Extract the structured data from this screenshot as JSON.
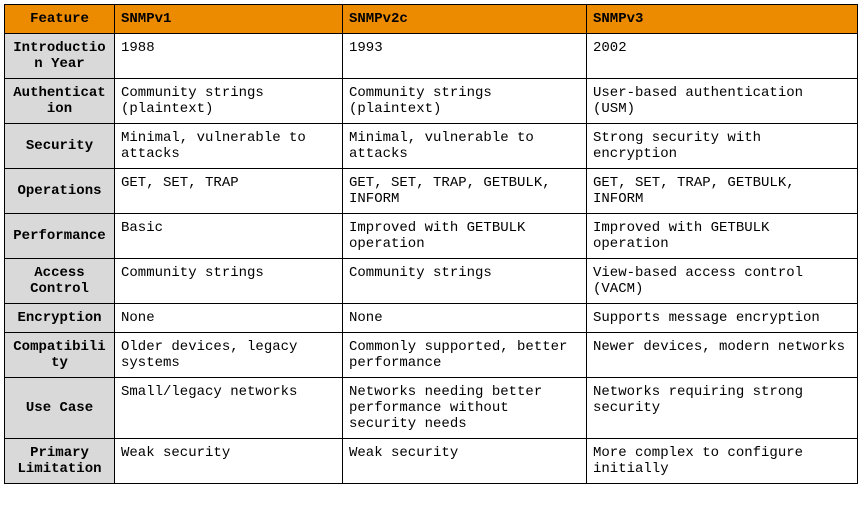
{
  "table": {
    "headers": {
      "feature": "Feature",
      "v1": "SNMPv1",
      "v2": "SNMPv2c",
      "v3": "SNMPv3"
    },
    "rows": [
      {
        "feature": "Introduction Year",
        "v1": "1988",
        "v2": "1993",
        "v3": "2002"
      },
      {
        "feature": "Authentication",
        "v1": "Community strings (plaintext)",
        "v2": "Community strings (plaintext)",
        "v3": "User-based authentication (USM)"
      },
      {
        "feature": "Security",
        "v1": "Minimal, vulnerable to attacks",
        "v2": "Minimal, vulnerable to attacks",
        "v3": "Strong security with encryption"
      },
      {
        "feature": "Operations",
        "v1": "GET, SET, TRAP",
        "v2": "GET, SET, TRAP, GETBULK, INFORM",
        "v3": "GET, SET, TRAP, GETBULK, INFORM"
      },
      {
        "feature": "Performance",
        "v1": "Basic",
        "v2": "Improved with GETBULK operation",
        "v3": "Improved with GETBULK operation"
      },
      {
        "feature": "Access Control",
        "v1": "Community strings",
        "v2": "Community strings",
        "v3": "View-based access control (VACM)"
      },
      {
        "feature": "Encryption",
        "v1": "None",
        "v2": "None",
        "v3": "Supports message encryption"
      },
      {
        "feature": "Compatibility",
        "v1": "Older devices, legacy systems",
        "v2": "Commonly supported, better performance",
        "v3": "Newer devices, modern networks"
      },
      {
        "feature": "Use Case",
        "v1": "Small/legacy networks",
        "v2": "Networks needing better performance without security needs",
        "v3": "Networks requiring strong security"
      },
      {
        "feature": "Primary Limitation",
        "v1": "Weak security",
        "v2": "Weak security",
        "v3": "More complex to configure initially"
      }
    ]
  }
}
